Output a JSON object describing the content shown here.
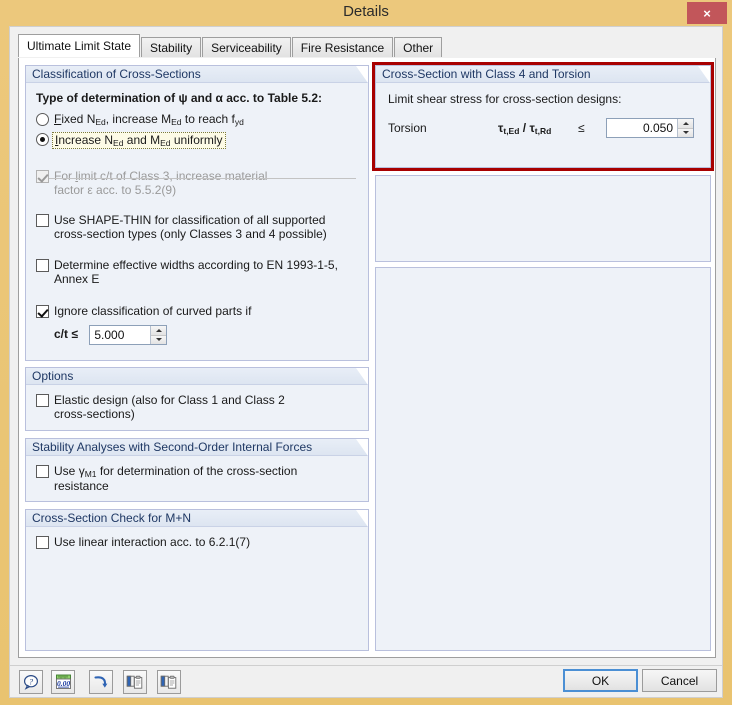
{
  "window": {
    "title": "Details",
    "close_label": "×",
    "accent_titlebar": "#e9c878",
    "accent_close": "#c2565a",
    "accent_highlight": "#a80000"
  },
  "tabs": [
    {
      "label": "Ultimate Limit State",
      "active": true
    },
    {
      "label": "Stability",
      "active": false
    },
    {
      "label": "Serviceability",
      "active": false
    },
    {
      "label": "Fire Resistance",
      "active": false
    },
    {
      "label": "Other",
      "active": false
    }
  ],
  "left": {
    "classification": {
      "header": "Classification of Cross-Sections",
      "type_label_pre": "Type of determination of ",
      "type_label_psi": "ψ",
      "type_label_mid": " and ",
      "type_label_alpha": "α",
      "type_label_post": " acc. to Table 5.2:",
      "radio_fixed": {
        "t1": "F",
        "t2": "ixed N",
        "sub1": "Ed",
        "t3": ", increase M",
        "sub2": "Ed",
        "t4": " to reach f",
        "sub3": "yd",
        "checked": false
      },
      "radio_increase": {
        "t1": "I",
        "t2": "ncrease N",
        "sub1": "Ed",
        "t3": " and M",
        "sub2": "Ed",
        "t4": " uniformly",
        "checked": true,
        "focused": true
      },
      "cb_limit": {
        "l1_a": "For ",
        "l1_b": "l",
        "l1_c": "imit c/t of Class 3, increase material",
        "l2": "factor ε acc. to 5.5.2(9)",
        "checked": true,
        "disabled": true
      },
      "cb_shapethin": {
        "l1": "Use SHAPE-THIN for classification of all supported",
        "l2": "cross-section types (only Classes 3 and 4 possible)",
        "checked": false
      },
      "cb_effective": {
        "l1": "Determine effective widths according to EN 1993-1-5, Annex E",
        "checked": false
      },
      "cb_ignore": {
        "l1": "Ignore classification of curved parts if",
        "checked": true
      },
      "ct_label": "c/t ≤",
      "ct_value": "5.000"
    },
    "options": {
      "header": "Options",
      "cb_elastic": {
        "l1": "Elastic design (also for Class 1 and Class 2",
        "l2": "cross-sections)",
        "checked": false
      }
    },
    "stability": {
      "header": "Stability Analyses with Second-Order Internal Forces",
      "cb_gamma": {
        "pre": "Use ",
        "gamma": "γ",
        "sub": "M1",
        "post": " for determination of the cross-section",
        "l2": "resistance",
        "checked": false
      }
    },
    "mn": {
      "header": "Cross-Section Check for M+N",
      "cb_linear": {
        "l1": "Use linear interaction acc. to 6.2.1(7)",
        "checked": false
      }
    }
  },
  "right": {
    "torsion": {
      "header": "Cross-Section with Class 4 and Torsion",
      "subtitle": "Limit shear stress for cross-section designs:",
      "row_label": "Torsion",
      "formula_tau1": "τ",
      "formula_sub1": "t,Ed",
      "formula_slash": " / ",
      "formula_tau2": "τ",
      "formula_sub2": "t,Rd",
      "operator": "≤",
      "value": "0.050",
      "highlighted": true
    },
    "empty_group_1": {
      "header": ""
    },
    "empty_group_2": {
      "header": ""
    }
  },
  "toolbar": {
    "buttons": [
      {
        "name": "help-icon",
        "glyph": "?"
      },
      {
        "name": "units-icon",
        "glyph": "0.00"
      },
      {
        "name": "restore-default-icon",
        "glyph": "↶"
      },
      {
        "name": "copy-settings-icon",
        "glyph": "⧉"
      },
      {
        "name": "paste-settings-icon",
        "glyph": "⧉"
      }
    ]
  },
  "footer": {
    "ok_label": "OK",
    "cancel_label": "Cancel"
  }
}
